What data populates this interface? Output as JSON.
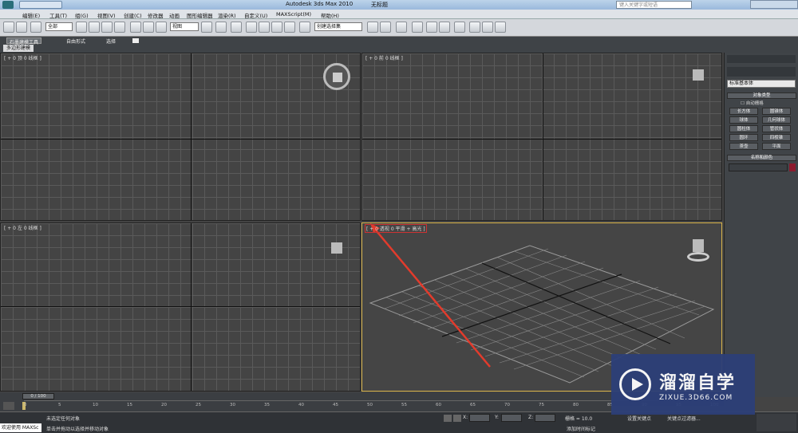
{
  "window": {
    "title": "Autodesk 3ds Max  2010",
    "doc_title": "无标题",
    "search_placeholder": "键入关键字或短语"
  },
  "menu": [
    "编辑(E)",
    "工具(T)",
    "组(G)",
    "视图(V)",
    "创建(C)",
    "修改器",
    "动画",
    "图形编辑器",
    "渲染(R)",
    "自定义(U)",
    "MAXScript(M)",
    "帮助(H)"
  ],
  "toolbar": {
    "selection_filter": "全部",
    "ref_coord": "视图",
    "named_selection": "创建选择集"
  },
  "ribbon": {
    "tabs": [
      "石墨建模工具",
      "自由形式",
      "选择"
    ],
    "sub_label": "多边形建模"
  },
  "viewports": {
    "top": "[ + 0 顶 0 线框 ]",
    "front": "[ + 0 前 0 线框 ]",
    "left": "[ + 0 左 0 线框 ]",
    "persp": "[ + 0 透视 0 平滑 + 高光 ]"
  },
  "command_panel": {
    "dropdown": "标准基本体",
    "section_object_type": "对象类型",
    "autogrid": "自动栅格",
    "buttons": [
      "长方体",
      "圆锥体",
      "球体",
      "几何球体",
      "圆柱体",
      "管状体",
      "圆环",
      "四棱锥",
      "茶壶",
      "平面"
    ],
    "section_name_color": "名称和颜色",
    "accent_color": "#8c1b2e"
  },
  "timeline": {
    "frame": "0 / 100",
    "ticks": [
      "0",
      "5",
      "10",
      "15",
      "20",
      "25",
      "30",
      "35",
      "40",
      "45",
      "50",
      "55",
      "60",
      "65",
      "70",
      "75",
      "80",
      "85",
      "90",
      "95",
      "100"
    ]
  },
  "status": {
    "welcome": "欢迎使用 MAXSc",
    "line1": "未选定任何对象",
    "line2": "单击并拖动以选择并移动对象",
    "x_label": "X:",
    "y_label": "Y:",
    "z_label": "Z:",
    "grid": "栅格 = 10.0",
    "add_time_tag": "添加时间标记",
    "set_key": "设置关键点",
    "key_filters": "关键点过滤器..."
  },
  "watermark": {
    "cn": "溜溜自学",
    "url": "ZIXUE.3D66.COM"
  }
}
